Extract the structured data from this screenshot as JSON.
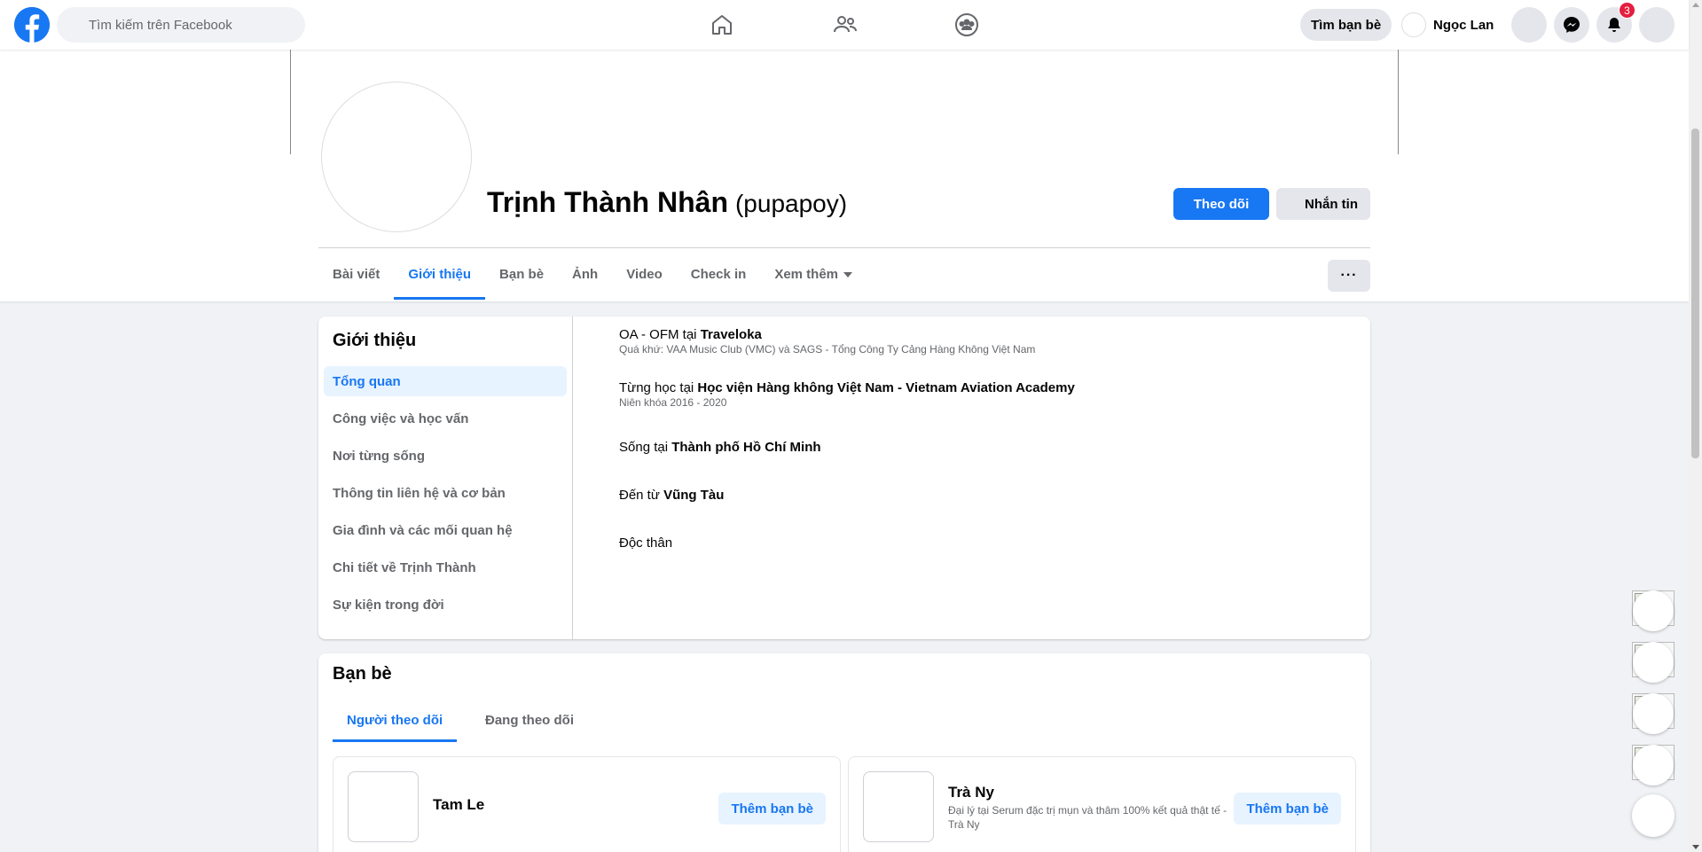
{
  "topbar": {
    "logo_icon": "facebook-logo-icon",
    "search_placeholder": "Tìm kiếm trên Facebook",
    "nav": [
      "home-icon",
      "friends-icon",
      "groups-icon"
    ],
    "find_friends_label": "Tìm bạn bè",
    "user_name": "Ngọc Lan",
    "notification_count": "3",
    "accent_color": "#1877f2",
    "badge_color": "#e41e3f"
  },
  "profile": {
    "name": "Trịnh Thành Nhân",
    "alt_name": "(pupapoy)",
    "follow_label": "Theo dõi",
    "message_label": "Nhắn tin",
    "more_label": "···",
    "tabs": [
      {
        "label": "Bài viết"
      },
      {
        "label": "Giới thiệu"
      },
      {
        "label": "Bạn bè"
      },
      {
        "label": "Ảnh"
      },
      {
        "label": "Video"
      },
      {
        "label": "Check in"
      },
      {
        "label": "Xem thêm"
      }
    ],
    "active_tab": "Giới thiệu"
  },
  "about": {
    "title": "Giới thiệu",
    "nav": [
      {
        "label": "Tổng quan"
      },
      {
        "label": "Công việc và học vấn"
      },
      {
        "label": "Nơi từng sống"
      },
      {
        "label": "Thông tin liên hệ và cơ bản"
      },
      {
        "label": "Gia đình và các mối quan hệ"
      },
      {
        "label": "Chi tiết về Trịnh Thành"
      },
      {
        "label": "Sự kiện trong đời"
      }
    ],
    "items": [
      {
        "prefix": "OA - OFM tại ",
        "bold": "Traveloka",
        "sub": "Quá khứ: VAA Music Club (VMC) và SAGS - Tổng Công Ty Cảng Hàng Không Việt Nam"
      },
      {
        "prefix": "Từng học tại ",
        "bold": "Học viện Hàng không Việt Nam - Vietnam Aviation Academy",
        "sub": "Niên khóa 2016 - 2020"
      },
      {
        "prefix": "Sống tại ",
        "bold": "Thành phố Hồ Chí Minh",
        "sub": ""
      },
      {
        "prefix": "Đến từ ",
        "bold": "Vũng Tàu",
        "sub": ""
      },
      {
        "prefix": "Độc thân",
        "bold": "",
        "sub": ""
      }
    ]
  },
  "friends": {
    "title": "Bạn bè",
    "tabs": [
      {
        "label": "Người theo dõi"
      },
      {
        "label": "Đang theo dõi"
      }
    ],
    "cards": [
      {
        "name": "Tam Le",
        "desc": "",
        "action": "Thêm bạn bè"
      },
      {
        "name": "Trà Ny",
        "desc": "Đại lý tại Serum đặc trị mụn và thâm 100% kết quả thật tế - Trà Ny",
        "action": "Thêm bạn bè"
      }
    ]
  }
}
